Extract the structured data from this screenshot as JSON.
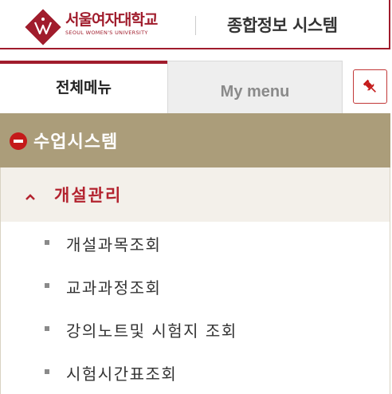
{
  "header": {
    "university_name": "서울여자대학교",
    "university_subtitle": "SEOUL WOMEN'S UNIVERSITY",
    "system_title": "종합정보 시스템"
  },
  "tabs": {
    "full_menu": "전체메뉴",
    "my_menu": "My menu"
  },
  "menu": {
    "category": "수업시스템",
    "subcategory": "개설관리",
    "items": [
      "개설과목조회",
      "교과과정조회",
      "강의노트및 시험지 조회",
      "시험시간표조회"
    ]
  },
  "colors": {
    "brand": "#a01c2c",
    "category_bar": "#ab9d7a",
    "minus_icon": "#c41a1a",
    "subcategory_text": "#b3232f"
  },
  "icons": {
    "logo": "university-crest-icon",
    "pin": "pushpin-icon",
    "collapse": "minus-circle-icon",
    "expanded": "chevron-up-icon",
    "bullet": "square-bullet-icon"
  }
}
